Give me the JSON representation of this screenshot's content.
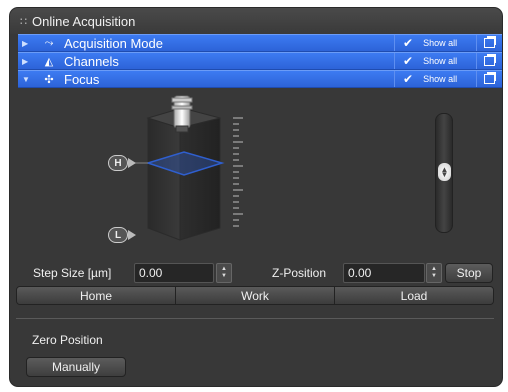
{
  "panel": {
    "title": "Online Acquisition",
    "grip_icon": "grip-dots-icon"
  },
  "sections": [
    {
      "label": "Acquisition Mode",
      "icon": "acquisition-mode-icon",
      "expanded": false,
      "show_all": "Show all"
    },
    {
      "label": "Channels",
      "icon": "channels-icon",
      "expanded": false,
      "show_all": "Show all"
    },
    {
      "label": "Focus",
      "icon": "focus-icon",
      "expanded": true,
      "show_all": "Show all"
    }
  ],
  "focus": {
    "high_marker": "H",
    "low_marker": "L",
    "step_size_label": "Step Size [µm]",
    "step_size_value": "0.00",
    "z_position_label": "Z-Position",
    "z_position_value": "0.00",
    "stop_label": "Stop",
    "position_buttons": [
      "Home",
      "Work",
      "Load"
    ],
    "zero_position_label": "Zero Position",
    "manually_label": "Manually"
  },
  "colors": {
    "accent_blue": "#3d7bf2",
    "panel_bg": "#383838",
    "focus_plane": "#2f5fcf"
  }
}
